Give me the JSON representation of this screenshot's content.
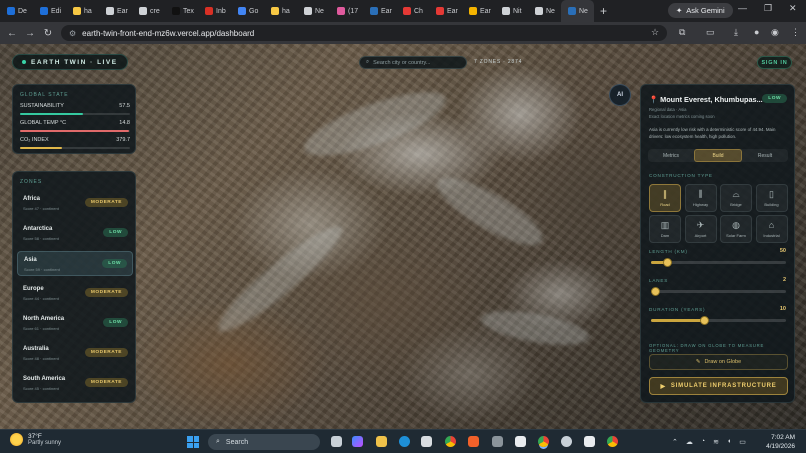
{
  "browser": {
    "tabs": [
      {
        "label": "De",
        "color": "#1e6fd9"
      },
      {
        "label": "Edi",
        "color": "#1e6fd9"
      },
      {
        "label": "ha",
        "color": "#f7c844"
      },
      {
        "label": "Ear",
        "color": "#cfd2d6"
      },
      {
        "label": "cre",
        "color": "#cfd2d6"
      },
      {
        "label": "Tex",
        "color": "#111111"
      },
      {
        "label": "Inb",
        "color": "#d93025"
      },
      {
        "label": "Go",
        "color": "#4285f4"
      },
      {
        "label": "ha",
        "color": "#f7c844"
      },
      {
        "label": "Ne",
        "color": "#cfd2d6"
      },
      {
        "label": "(17",
        "color": "#e05a9d"
      },
      {
        "label": "Ear",
        "color": "#2a6fb8"
      },
      {
        "label": "Ch",
        "color": "#e53935"
      },
      {
        "label": "Ear",
        "color": "#e53935"
      },
      {
        "label": "Ear",
        "color": "#f5b400"
      },
      {
        "label": "Nit",
        "color": "#cfd2d6"
      },
      {
        "label": "Ne",
        "color": "#cfd2d6"
      },
      {
        "label": "Ne",
        "color": "#2a6fb8"
      }
    ],
    "new_tab": "+",
    "gemini_label": "Ask Gemini",
    "url": "earth-twin-front-end-mz6w.vercel.app/dashboard"
  },
  "header": {
    "logo": "EARTH TWIN · LIVE",
    "search_placeholder": "Search city or country...",
    "zone_count": "7 ZONES · 2874",
    "sign_in": "SIGN IN"
  },
  "global_state": {
    "title": "GLOBAL STATE",
    "metrics": [
      {
        "label": "SUSTAINABILITY",
        "value": "57.5",
        "fill": 0.575,
        "color": "#35c9a0"
      },
      {
        "label": "GLOBAL TEMP °C",
        "value": "14.8",
        "fill": 0.99,
        "color": "#e06a6a"
      },
      {
        "label": "CO₂ INDEX",
        "value": "379.7",
        "fill": 0.38,
        "color": "#e0b84a"
      }
    ]
  },
  "zones": {
    "title": "ZONES",
    "items": [
      {
        "name": "Africa",
        "sub": "Score 47 · continent",
        "risk": "MODERATE",
        "level": "mod"
      },
      {
        "name": "Antarctica",
        "sub": "Score 58 · continent",
        "risk": "LOW",
        "level": "low"
      },
      {
        "name": "Asia",
        "sub": "Score 59 · continent",
        "risk": "LOW",
        "level": "low"
      },
      {
        "name": "Europe",
        "sub": "Score 44 · continent",
        "risk": "MODERATE",
        "level": "mod"
      },
      {
        "name": "North America",
        "sub": "Score 61 · continent",
        "risk": "LOW",
        "level": "low"
      },
      {
        "name": "Australia",
        "sub": "Score 48 · continent",
        "risk": "MODERATE",
        "level": "mod"
      },
      {
        "name": "South America",
        "sub": "Score 45 · continent",
        "risk": "MODERATE",
        "level": "mod"
      }
    ]
  },
  "ai_button": "AI",
  "location": {
    "title": "Mount Everest, Khumbupas...",
    "risk": "LOW",
    "line1": "Regional data · Asia",
    "line2": "Exact location metrics coming soon",
    "description": "Asia is currently low risk with a deterministic score of 44.94. Main drivers: low ecosystem health, high pollution.",
    "tabs": [
      "Metrics",
      "Build",
      "Result"
    ],
    "construction_title": "CONSTRUCTION TYPE",
    "types": [
      {
        "label": "Road",
        "icon": "∥"
      },
      {
        "label": "Highway",
        "icon": "⫼"
      },
      {
        "label": "Bridge",
        "icon": "⌓"
      },
      {
        "label": "Building",
        "icon": "▯"
      },
      {
        "label": "Dam",
        "icon": "▥"
      },
      {
        "label": "Airport",
        "icon": "✈"
      },
      {
        "label": "Solar Farm",
        "icon": "◍"
      },
      {
        "label": "Industrial",
        "icon": "⌂"
      }
    ],
    "sliders": [
      {
        "label": "LENGTH (KM)",
        "value": "50",
        "fill": 0.12
      },
      {
        "label": "LANES",
        "value": "2",
        "fill": 0.03
      },
      {
        "label": "DURATION (YEARS)",
        "value": "10",
        "fill": 0.39
      }
    ],
    "optional_note": "OPTIONAL: DRAW ON GLOBE TO MEASURE GEOMETRY",
    "draw_label": "Draw on Globe",
    "simulate_label": "SIMULATE INFRASTRUCTURE"
  },
  "taskbar": {
    "temperature": "37°F",
    "condition": "Partly sunny",
    "search": "Search",
    "time": "7:02 AM",
    "date": "4/19/2026"
  }
}
